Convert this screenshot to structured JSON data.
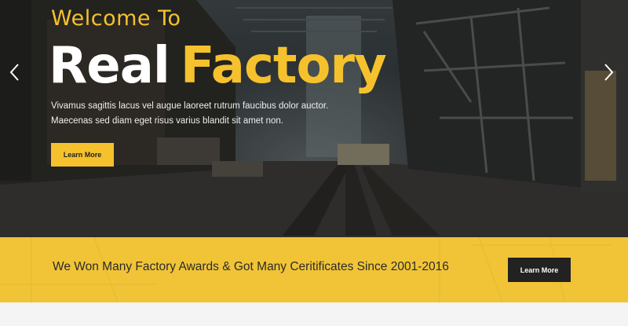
{
  "colors": {
    "accent": "#f5c12d",
    "dark": "#222222",
    "banner": "#f0c233"
  },
  "hero": {
    "welcome": "Welcome To",
    "title_part1": "Real",
    "title_part2": "Factory",
    "description_line1": "Vivamus sagittis lacus vel augue laoreet rutrum faucibus dolor auctor.",
    "description_line2": "Maecenas sed diam eget risus varius blandit sit amet non.",
    "button_label": "Learn More",
    "prev_icon": "chevron-left-icon",
    "next_icon": "chevron-right-icon"
  },
  "banner": {
    "text": "We Won Many Factory Awards & Got Many Ceritificates Since 2001-2016",
    "button_label": "Learn More"
  }
}
